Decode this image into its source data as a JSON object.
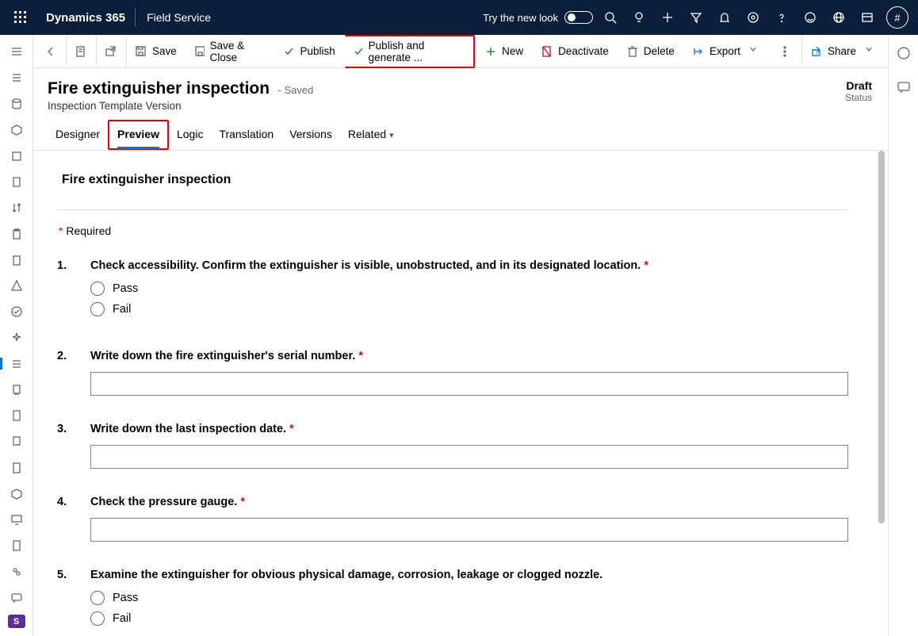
{
  "topnav": {
    "brand": "Dynamics 365",
    "app": "Field Service",
    "try_look": "Try the new look",
    "avatar_text": "#"
  },
  "commandbar": {
    "save": "Save",
    "save_close": "Save & Close",
    "publish": "Publish",
    "publish_gen": "Publish and generate ...",
    "new": "New",
    "deactivate": "Deactivate",
    "delete": "Delete",
    "export": "Export",
    "share": "Share"
  },
  "header": {
    "title": "Fire extinguisher inspection",
    "saved": "- Saved",
    "subtitle": "Inspection Template Version",
    "status_value": "Draft",
    "status_label": "Status"
  },
  "tabs": {
    "designer": "Designer",
    "preview": "Preview",
    "logic": "Logic",
    "translation": "Translation",
    "versions": "Versions",
    "related": "Related"
  },
  "preview": {
    "form_title": "Fire extinguisher inspection",
    "required_label": " Required",
    "questions": [
      {
        "num": "1.",
        "text": "Check accessibility. Confirm the extinguisher is visible, unobstructed, and in its designated location.",
        "required": true,
        "type": "radio",
        "options": [
          "Pass",
          "Fail"
        ]
      },
      {
        "num": "2.",
        "text": "Write down the fire extinguisher's serial number.",
        "required": true,
        "type": "text"
      },
      {
        "num": "3.",
        "text": "Write down the last inspection date.",
        "required": true,
        "type": "text"
      },
      {
        "num": "4.",
        "text": "Check the pressure gauge.",
        "required": true,
        "type": "text"
      },
      {
        "num": "5.",
        "text": "Examine the extinguisher for obvious physical damage, corrosion, leakage or clogged nozzle.",
        "required": false,
        "type": "radio",
        "options": [
          "Pass",
          "Fail"
        ]
      }
    ]
  },
  "leftrail_app": "S"
}
